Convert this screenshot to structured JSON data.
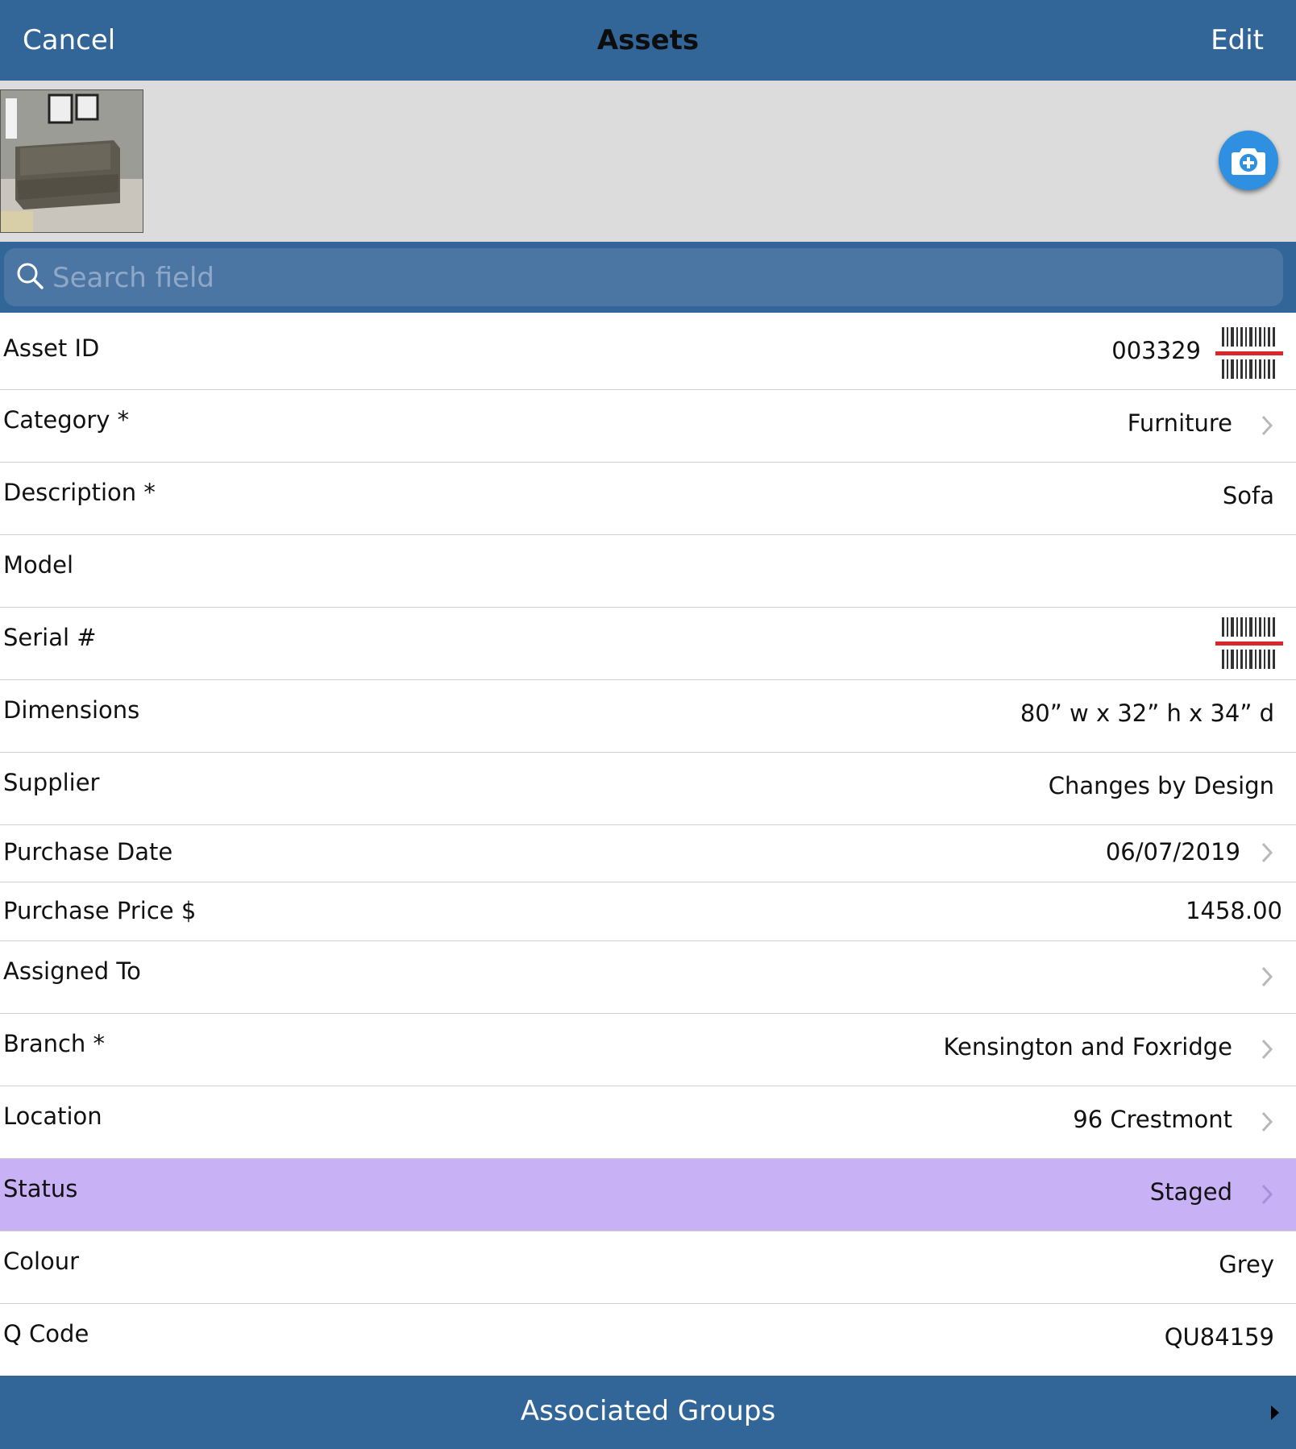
{
  "navbar": {
    "cancel_label": "Cancel",
    "title": "Assets",
    "edit_label": "Edit"
  },
  "search": {
    "placeholder": "Search field"
  },
  "fields": {
    "asset_id": {
      "label": "Asset ID",
      "value": "003329"
    },
    "category": {
      "label": "Category *",
      "value": "Furniture"
    },
    "description": {
      "label": "Description *",
      "value": "Sofa"
    },
    "model": {
      "label": "Model",
      "value": ""
    },
    "serial": {
      "label": "Serial #",
      "value": ""
    },
    "dimensions": {
      "label": "Dimensions",
      "value": "80” w x 32” h x 34” d"
    },
    "supplier": {
      "label": "Supplier",
      "value": "Changes by Design"
    },
    "purchase_date": {
      "label": "Purchase Date",
      "value": "06/07/2019"
    },
    "purchase_price": {
      "label": "Purchase Price $",
      "value": "1458.00"
    },
    "assigned_to": {
      "label": "Assigned To",
      "value": ""
    },
    "branch": {
      "label": "Branch *",
      "value": "Kensington and Foxridge"
    },
    "location": {
      "label": "Location",
      "value": "96 Crestmont"
    },
    "status": {
      "label": "Status",
      "value": "Staged"
    },
    "colour": {
      "label": "Colour",
      "value": "Grey"
    },
    "q_code": {
      "label": "Q Code",
      "value": "QU84159"
    }
  },
  "footer": {
    "label": "Associated Groups"
  },
  "icons": {
    "camera": "camera-add-icon",
    "search": "search-icon",
    "barcode": "barcode-scan-icon",
    "chevron": "chevron-right-icon",
    "footer_arrow": "triangle-right-icon"
  },
  "colors": {
    "navbar": "#326598",
    "search_field": "#4b76a3",
    "status_highlight": "#c8b1f5",
    "camera_button": "#2f8fe0",
    "barcode_scan_line": "#d9262a"
  }
}
